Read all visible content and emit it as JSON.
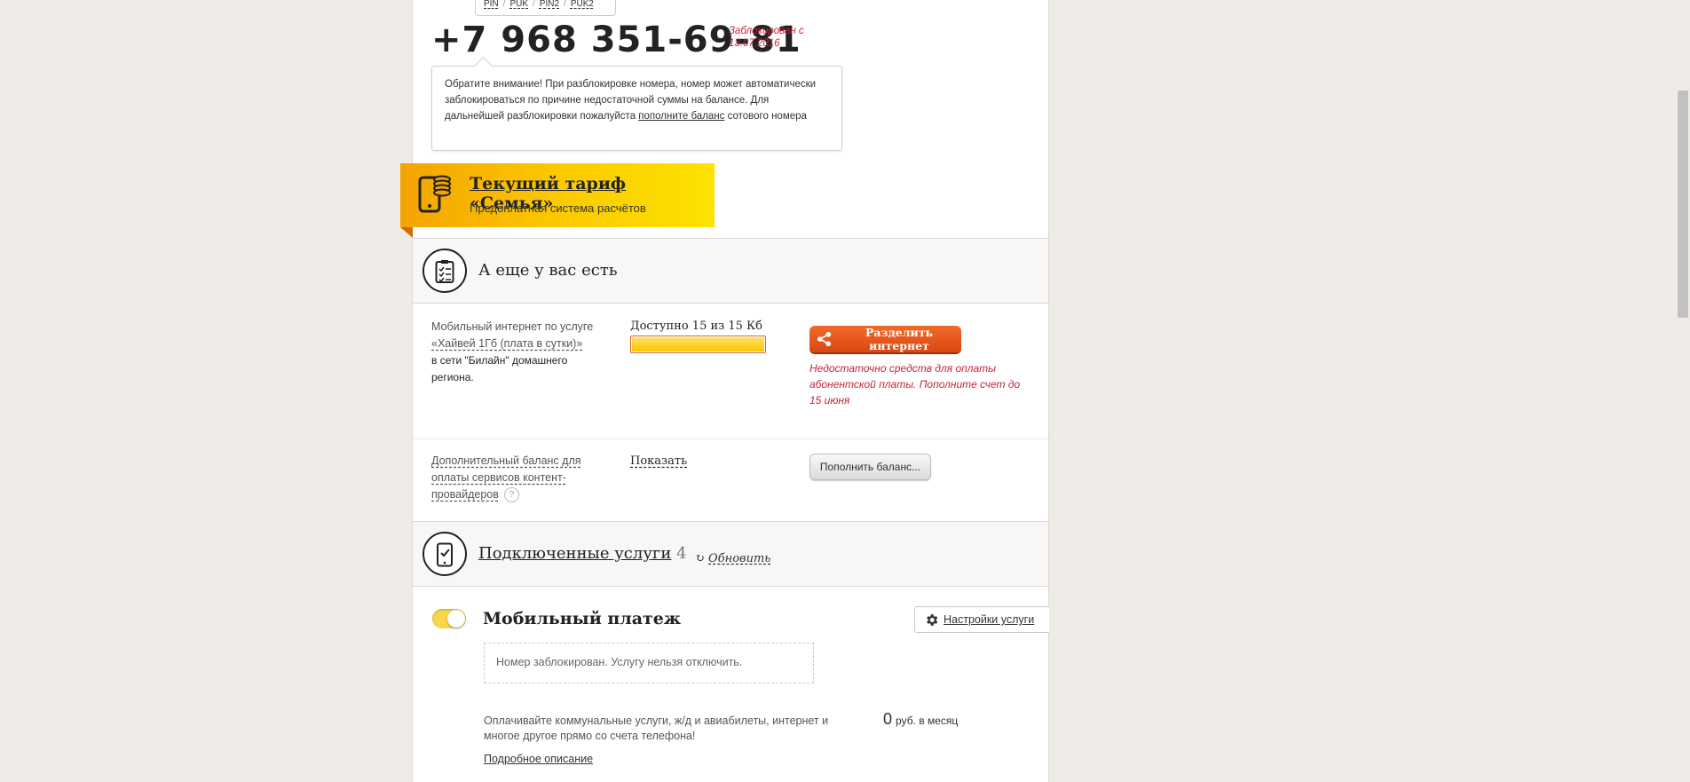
{
  "pin_links": [
    "PIN",
    "PUK",
    "PIN2",
    "PUK2"
  ],
  "phone": {
    "number": "+7 968 351-69-81",
    "blocked_status": "Заблокирован с 13.07.2016"
  },
  "notice": {
    "text_before": "Обратите внимание! При разблокировке номера, номер может автоматически заблокироваться по причине недостаточной суммы на балансе. Для дальнейшей разблокировки пожалуйста ",
    "link": "пополните баланс",
    "text_after": " сотового номера"
  },
  "tariff": {
    "title_link": "Текущий тариф",
    "name": "«Семья»",
    "subtitle": "Предоплатная система расчётов"
  },
  "extras": {
    "title": "А еще у вас есть",
    "internet": {
      "line1": "Мобильный интернет по услуге",
      "service_link": "«Хайвей 1Гб (плата в сутки)»",
      "line2": "в сети \"Билайн\" домашнего региона.",
      "available": "Доступно 15 из 15 Кб",
      "progress_fraction": 1.0,
      "share_button": "Разделить интернет",
      "error": "Недостаточно средств для оплаты абонентской платы. Пополните счет до 15 июня"
    },
    "balance": {
      "label": "Дополнительный баланс для оплаты сервисов контент-провайдеров",
      "help": "?",
      "show_link": "Показать",
      "topup_button": "Пополнить баланс..."
    }
  },
  "services": {
    "title": "Подключенные услуги",
    "count": "4",
    "refresh": "Обновить",
    "item": {
      "name": "Мобильный платеж",
      "enabled": true,
      "settings": "Настройки услуги",
      "blocked_msg": "Номер заблокирован. Услугу нельзя отключить.",
      "description": "Оплачивайте коммунальные услуги, ж/д и авиабилеты, интернет и многое другое прямо со счета телефона!",
      "price_value": "0",
      "price_unit": "руб. в месяц",
      "more": "Подробное описание"
    }
  },
  "colors": {
    "accent_yellow": "#fbc900",
    "accent_orange": "#e2531b",
    "error_red": "#c5243a"
  }
}
